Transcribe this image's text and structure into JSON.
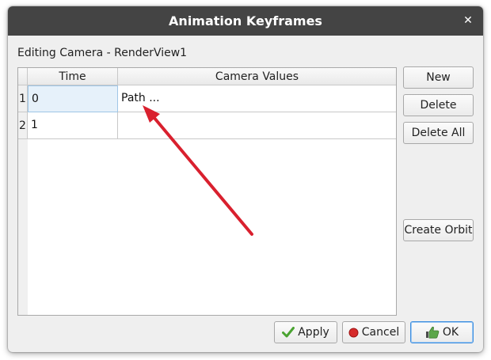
{
  "window": {
    "title": "Animation Keyframes",
    "close_glyph": "✕"
  },
  "subtitle": "Editing Camera - RenderView1",
  "table": {
    "columns": [
      "Time",
      "Camera Values"
    ],
    "rows": [
      {
        "num": "1",
        "time": "0",
        "camera": "Path ..."
      },
      {
        "num": "2",
        "time": "1",
        "camera": ""
      }
    ]
  },
  "side_buttons": {
    "new": "New",
    "delete": "Delete",
    "delete_all": "Delete All",
    "create_orbit": "Create Orbit"
  },
  "bottom_buttons": {
    "apply": {
      "label": "Apply",
      "icon": "checkmark-icon"
    },
    "cancel": {
      "label": "Cancel",
      "icon": "red-circle-icon"
    },
    "ok": {
      "label": "OK",
      "icon": "thumbs-up-icon"
    }
  },
  "annotation": {
    "icon": "red-arrow-annotation",
    "color": "#d9202e"
  },
  "colors": {
    "titlebar": "#444444",
    "selection": "#e6f1fa",
    "ok_border": "#3d8ee0"
  }
}
